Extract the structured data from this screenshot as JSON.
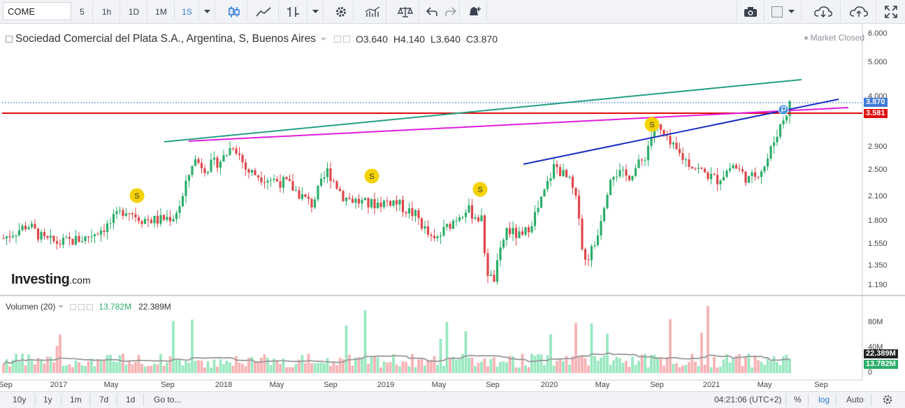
{
  "toolbar": {
    "symbol": "COME",
    "intervals": [
      "5",
      "1h",
      "1D",
      "1M",
      "1S"
    ],
    "active_interval": "1S"
  },
  "legend": {
    "title": "Sociedad Comercial del Plata S.A., Argentina, S, Buenos Aires",
    "open": "O3.640",
    "high": "H4.140",
    "low": "L3.640",
    "close": "C3.870",
    "status": "Market Closed"
  },
  "volume_legend": {
    "label": "Volumen (20)",
    "value1": "13.782M",
    "value2": "22.389M"
  },
  "watermark": {
    "brand": "Investing",
    "suffix": ".com"
  },
  "price_axis": {
    "labels": [
      "6.000",
      "5.000",
      "4.000",
      "2.900",
      "2.500",
      "2.100",
      "1.800",
      "1.550",
      "1.350",
      "1.190"
    ],
    "last_price_badge": "3.870",
    "line_badge": "3.581"
  },
  "volume_axis": {
    "labels": [
      "80M",
      "40M",
      "0"
    ],
    "badge_ma": "22.389M",
    "badge_vol": "13.782M"
  },
  "time_axis": {
    "labels": [
      "Sep",
      "2017",
      "May",
      "Sep",
      "2018",
      "May",
      "Sep",
      "2019",
      "May",
      "Sep",
      "2020",
      "May",
      "Sep",
      "2021",
      "May",
      "Sep"
    ]
  },
  "dividend_markers": [
    "S",
    "S",
    "S",
    "S"
  ],
  "bottom_bar": {
    "ranges": [
      "10y",
      "1y",
      "1m",
      "7d",
      "1d"
    ],
    "goto": "Go to...",
    "time": "04:21:06 (UTC+2)",
    "percent": "%",
    "log": "log",
    "auto": "Auto"
  },
  "colors": {
    "up": "#2bae6a",
    "down": "#e0464a",
    "vol_up": "#9be8c1",
    "vol_down": "#f7b3b5",
    "green_line": "#23a083",
    "magenta_line": "#e11de0",
    "blue_line": "#1b2ec6",
    "red_line": "#e00d0d",
    "badge_blue": "#3f79d7",
    "badge_red": "#e00d0d",
    "active": "#2f7ad5"
  },
  "chart_data": {
    "type": "candlestick",
    "symbol": "COME",
    "interval": "1S",
    "scale": "log",
    "open": 3.64,
    "high": 4.14,
    "low": 3.64,
    "close": 3.87,
    "price_range": [
      1.1,
      6.2
    ],
    "approx_close_path": [
      [
        2016.7,
        1.6
      ],
      [
        2016.85,
        1.75
      ],
      [
        2016.95,
        1.58
      ],
      [
        2017.05,
        1.55
      ],
      [
        2017.2,
        1.6
      ],
      [
        2017.35,
        1.75
      ],
      [
        2017.45,
        1.95
      ],
      [
        2017.55,
        1.82
      ],
      [
        2017.65,
        1.8
      ],
      [
        2017.75,
        1.85
      ],
      [
        2017.8,
        2.05
      ],
      [
        2017.87,
        2.7
      ],
      [
        2017.95,
        2.55
      ],
      [
        2018.05,
        2.7
      ],
      [
        2018.12,
        3.0
      ],
      [
        2018.2,
        2.5
      ],
      [
        2018.3,
        2.4
      ],
      [
        2018.45,
        2.3
      ],
      [
        2018.6,
        2.0
      ],
      [
        2018.7,
        2.5
      ],
      [
        2018.8,
        2.1
      ],
      [
        2018.95,
        2.0
      ],
      [
        2019.1,
        2.05
      ],
      [
        2019.25,
        1.85
      ],
      [
        2019.35,
        1.55
      ],
      [
        2019.45,
        1.75
      ],
      [
        2019.55,
        1.95
      ],
      [
        2019.65,
        1.8
      ],
      [
        2019.68,
        1.3
      ],
      [
        2019.72,
        1.19
      ],
      [
        2019.8,
        1.7
      ],
      [
        2019.9,
        1.6
      ],
      [
        2020.0,
        1.95
      ],
      [
        2020.1,
        2.6
      ],
      [
        2020.2,
        2.3
      ],
      [
        2020.25,
        1.9
      ],
      [
        2020.28,
        1.35
      ],
      [
        2020.35,
        1.55
      ],
      [
        2020.45,
        2.5
      ],
      [
        2020.55,
        2.4
      ],
      [
        2020.65,
        2.7
      ],
      [
        2020.72,
        3.4
      ],
      [
        2020.8,
        3.0
      ],
      [
        2020.9,
        2.7
      ],
      [
        2021.0,
        2.5
      ],
      [
        2021.1,
        2.35
      ],
      [
        2021.2,
        2.6
      ],
      [
        2021.3,
        2.35
      ],
      [
        2021.4,
        2.6
      ],
      [
        2021.47,
        3.2
      ],
      [
        2021.55,
        3.87
      ]
    ]
  }
}
